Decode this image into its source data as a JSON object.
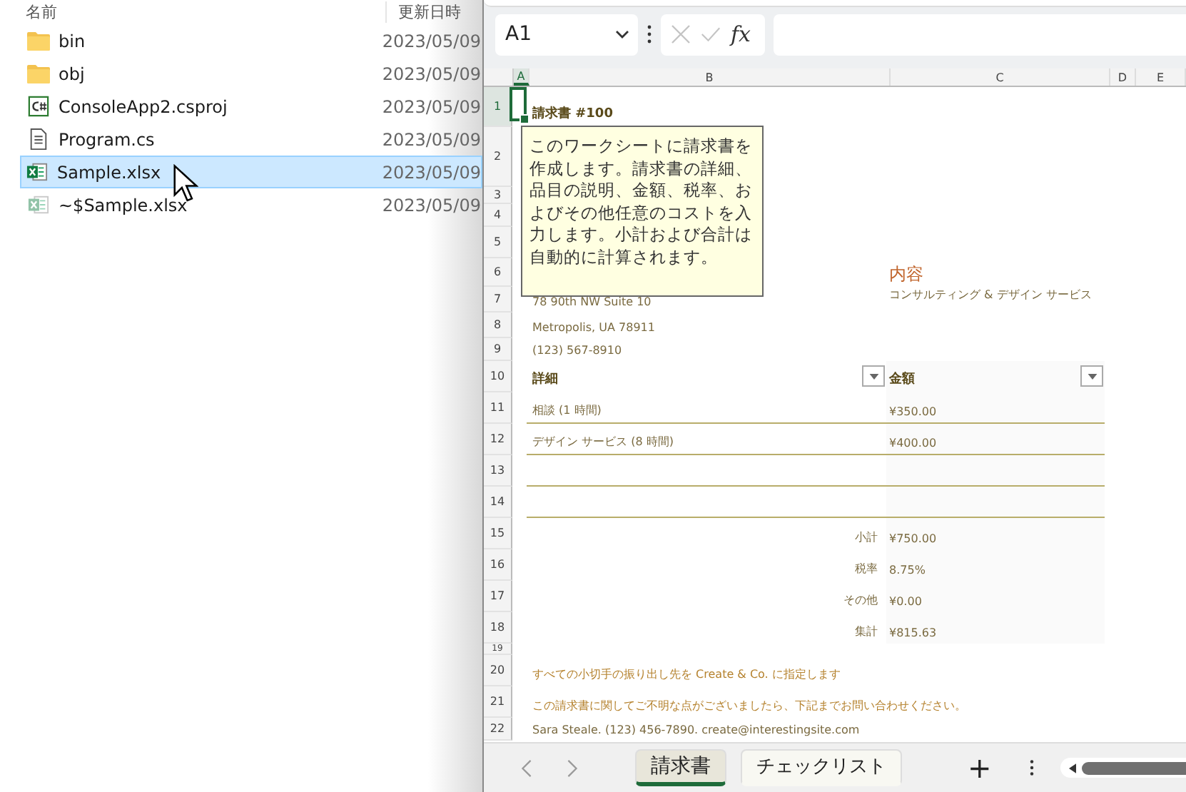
{
  "explorer": {
    "columns": [
      "名前",
      "更新日時"
    ],
    "files": [
      {
        "name": "bin",
        "kind": "folder",
        "modified": "2023/05/09",
        "selected": false
      },
      {
        "name": "obj",
        "kind": "folder",
        "modified": "2023/05/09",
        "selected": false
      },
      {
        "name": "ConsoleApp2.csproj",
        "kind": "project",
        "modified": "2023/05/09",
        "selected": false
      },
      {
        "name": "Program.cs",
        "kind": "code",
        "modified": "2023/05/09",
        "selected": false
      },
      {
        "name": "Sample.xlsx",
        "kind": "excel",
        "modified": "2023/05/09",
        "selected": true
      },
      {
        "name": "~$Sample.xlsx",
        "kind": "excel-temp",
        "modified": "2023/05/09",
        "selected": false
      }
    ]
  },
  "excel": {
    "name_box": "A1",
    "formula_button": "fx",
    "column_headers": [
      "A",
      "B",
      "C",
      "D",
      "E"
    ],
    "rows": [
      {
        "number": "1",
        "kind": "title",
        "b": "請求書 #100"
      },
      {
        "number": "2",
        "kind": "blank"
      },
      {
        "number": "3",
        "kind": "blank"
      },
      {
        "number": "4",
        "kind": "blank"
      },
      {
        "number": "5",
        "kind": "blank"
      },
      {
        "number": "6",
        "kind": "heading",
        "c": "内容"
      },
      {
        "number": "7",
        "kind": "address",
        "b": "78 90th NW Suite 10",
        "c": "コンサルティング & デザイン サービス"
      },
      {
        "number": "8",
        "kind": "address",
        "b": "Metropolis, UA 78911"
      },
      {
        "number": "9",
        "kind": "address",
        "b": "(123) 567-8910"
      },
      {
        "number": "10",
        "kind": "header",
        "b": "詳細",
        "c": "金額"
      },
      {
        "number": "11",
        "kind": "item",
        "b": "相談 (1 時間)",
        "c": "¥350.00"
      },
      {
        "number": "12",
        "kind": "item",
        "b": "デザイン サービス (8 時間)",
        "c": "¥400.00"
      },
      {
        "number": "13",
        "kind": "item"
      },
      {
        "number": "14",
        "kind": "item"
      },
      {
        "number": "15",
        "kind": "summary",
        "b": "小計",
        "c": "¥750.00"
      },
      {
        "number": "16",
        "kind": "summary",
        "b": "税率",
        "c": "8.75%"
      },
      {
        "number": "17",
        "kind": "summary",
        "b": "その他",
        "c": "¥0.00"
      },
      {
        "number": "18",
        "kind": "summary",
        "b": "集計",
        "c": "¥815.63"
      },
      {
        "number": "19",
        "kind": "tiny"
      },
      {
        "number": "20",
        "kind": "note",
        "b": "すべての小切手の振り出し先を Create & Co. に指定します"
      },
      {
        "number": "21",
        "kind": "note",
        "b": "この請求書に関してご不明な点がございましたら、下記までお問い合わせください。"
      },
      {
        "number": "22",
        "kind": "address",
        "b": "Sara Steale. (123) 456-7890. create@interestingsite.com"
      }
    ],
    "comment": "このワークシートに請求書を作成します。請求書の詳細、品目の説明、金額、税率、およびその他任意のコストを入力します。小計および合計は自動的に計算されます。",
    "sheet_tabs": [
      {
        "label": "請求書",
        "selected": true
      },
      {
        "label": "チェックリスト",
        "selected": false
      }
    ],
    "add_sheet": "+"
  }
}
